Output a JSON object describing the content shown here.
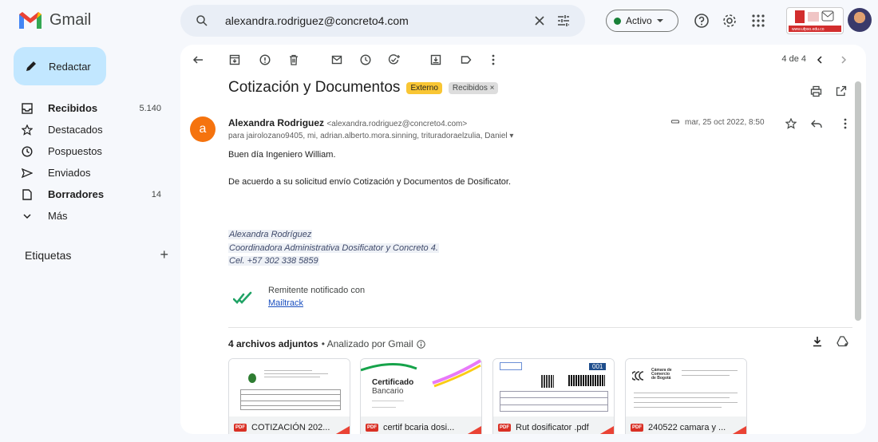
{
  "app": {
    "name": "Gmail"
  },
  "search": {
    "query": "alexandra.rodriguez@concreto4.com"
  },
  "status": {
    "label": "Activo"
  },
  "account_logo": {
    "url_text": "www.ufpso.edu.co"
  },
  "compose": {
    "label": "Redactar"
  },
  "nav": [
    {
      "label": "Recibidos",
      "count": "5.140",
      "bold": true,
      "icon": "inbox-icon"
    },
    {
      "label": "Destacados",
      "count": "",
      "bold": false,
      "icon": "star-icon"
    },
    {
      "label": "Pospuestos",
      "count": "",
      "bold": false,
      "icon": "clock-icon"
    },
    {
      "label": "Enviados",
      "count": "",
      "bold": false,
      "icon": "send-icon"
    },
    {
      "label": "Borradores",
      "count": "14",
      "bold": true,
      "icon": "file-icon"
    },
    {
      "label": "Más",
      "count": "",
      "bold": false,
      "icon": "chevron-down-icon"
    }
  ],
  "labels_section": {
    "title": "Etiquetas",
    "add": "+"
  },
  "toolbar": {
    "pager": "4 de 4"
  },
  "email": {
    "subject": "Cotización y Documentos",
    "chip_external": "Externo",
    "chip_inbox": "Recibidos ×",
    "avatar_letter": "a",
    "sender_name": "Alexandra Rodriguez",
    "sender_address": "<alexandra.rodriguez@concreto4.com>",
    "recipients": "para jairolozano9405, mi, adrian.alberto.mora.sinning, trituradoraelzulia, Daniel ▾",
    "date": "mar, 25 oct 2022, 8:50",
    "greeting": "Buen día Ingeniero William.",
    "body": "De acuerdo a su solicitud envío Cotización y Documentos de Dosificator.",
    "signature": [
      "Alexandra Rodríguez",
      "Coordinadora Administrativa Dosificator y Concreto 4.",
      "Cel. +57 302 338 5859"
    ],
    "mailtrack_text": "Remitente notificado con",
    "mailtrack_link": "Mailtrack"
  },
  "attachments": {
    "count_label": "4 archivos adjuntos",
    "scan_label": "• Analizado por Gmail",
    "items": [
      {
        "name": "COTIZACIÓN 202...",
        "preview": "doc"
      },
      {
        "name": "certif bcaria dosi...",
        "preview": "cert",
        "title": "Certificado",
        "subtitle": "Bancario"
      },
      {
        "name": "Rut dosificator .pdf",
        "preview": "rut",
        "badge": "001"
      },
      {
        "name": "240522 camara y ...",
        "preview": "camara",
        "org": "Cámara de Comercio de Bogotá"
      }
    ]
  }
}
